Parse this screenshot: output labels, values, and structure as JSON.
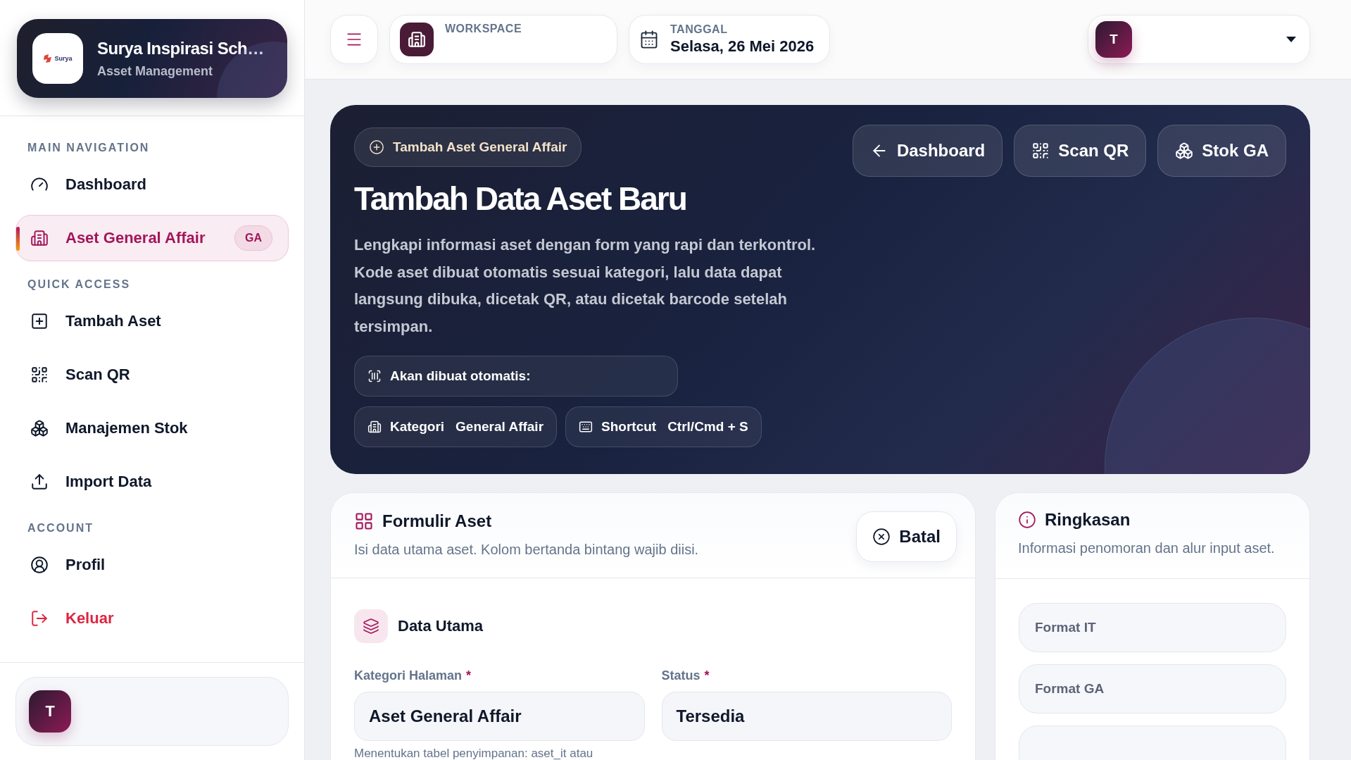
{
  "sidebar": {
    "brand": {
      "logo_text": "Surya",
      "title": "Surya Inspirasi Sch…",
      "subtitle": "Asset Management"
    },
    "sections": [
      {
        "heading": "MAIN NAVIGATION",
        "items": [
          {
            "label": "Dashboard",
            "selected": false,
            "danger": false
          },
          {
            "label": "Aset General Affair",
            "selected": true,
            "danger": false,
            "badge": "GA"
          }
        ]
      },
      {
        "heading": "QUICK ACCESS",
        "items": [
          {
            "label": "Tambah Aset",
            "selected": false,
            "danger": false
          },
          {
            "label": "Scan QR",
            "selected": false,
            "danger": false
          },
          {
            "label": "Manajemen Stok",
            "selected": false,
            "danger": false
          },
          {
            "label": "Import Data",
            "selected": false,
            "danger": false
          }
        ]
      },
      {
        "heading": "ACCOUNT",
        "items": [
          {
            "label": "Profil",
            "selected": false,
            "danger": false
          },
          {
            "label": "Keluar",
            "selected": false,
            "danger": true
          }
        ]
      }
    ],
    "user": {
      "initial": "T"
    }
  },
  "topbar": {
    "workspace": {
      "label": "WORKSPACE"
    },
    "date": {
      "label": "TANGGAL",
      "value": "Selasa, 26 Mei 2026"
    },
    "user": {
      "initial": "T"
    }
  },
  "hero": {
    "pill": "Tambah Aset General Affair",
    "title": "Tambah Data Aset Baru",
    "description": "Lengkapi informasi aset dengan form yang rapi dan terkontrol. Kode aset dibuat otomatis sesuai kategori, lalu data dapat langsung dibuka, dicetak QR, atau dicetak barcode setelah tersimpan.",
    "actions": [
      {
        "label": "Dashboard"
      },
      {
        "label": "Scan QR"
      },
      {
        "label": "Stok GA"
      }
    ],
    "chips": [
      {
        "label": "Akan dibuat otomatis:"
      },
      {
        "label": "Kategori",
        "value": "General Affair"
      },
      {
        "label": "Shortcut",
        "value": "Ctrl/Cmd + S"
      }
    ]
  },
  "form": {
    "title": "Formulir Aset",
    "subtitle": "Isi data utama aset. Kolom bertanda bintang wajib diisi.",
    "cancel": "Batal",
    "section": "Data Utama",
    "fields": [
      {
        "label": "Kategori Halaman",
        "required_mark": "*",
        "value": "Aset General Affair",
        "hint": "Menentukan tabel penyimpanan: aset_it atau"
      },
      {
        "label": "Status",
        "required_mark": "*",
        "value": "Tersedia"
      }
    ]
  },
  "summary": {
    "title": "Ringkasan",
    "subtitle": "Informasi penomoran dan alur input aset.",
    "items": [
      {
        "label": "Format IT"
      },
      {
        "label": "Format GA"
      }
    ]
  }
}
